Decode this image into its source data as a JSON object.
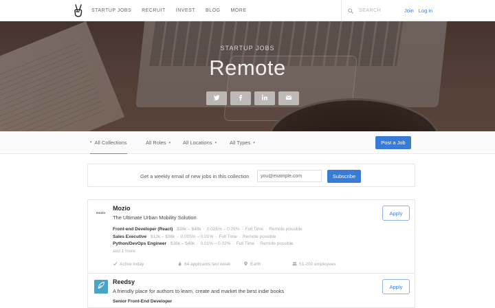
{
  "nav": {
    "links": [
      "STARTUP JOBS",
      "RECRUIT",
      "INVEST",
      "BLOG",
      "MORE"
    ],
    "search_placeholder": "SEARCH",
    "join": "Join",
    "login": "Log in"
  },
  "hero": {
    "subtitle": "STARTUP JOBS",
    "title": "Remote",
    "share_icons": [
      "twitter-icon",
      "facebook-icon",
      "linkedin-icon",
      "email-icon"
    ]
  },
  "filters": {
    "items": [
      "All Collections",
      "All Roles",
      "All Locations",
      "All Types"
    ],
    "post_job": "Post a Job"
  },
  "subscribe": {
    "text": "Get a weekly email of new jobs in this collection",
    "placeholder": "you@example.com",
    "button": "Subscribe"
  },
  "companies": [
    {
      "logo_text": "mozio",
      "name": "Mozio",
      "tagline": "The Ultimate Urban Mobility Solution",
      "apply": "Apply",
      "jobs": [
        {
          "title": "Front-end Developer (React)",
          "salary": "$36k – $48k",
          "equity": "0.025% – 0.05%",
          "type": "Full Time",
          "remote": "Remote possible"
        },
        {
          "title": "Sales Executive",
          "salary": "$12k – $36k",
          "equity": "0.005% – 0.01%",
          "type": "Full Time",
          "remote": "Remote possible"
        },
        {
          "title": "Python/DevOps Engineer",
          "salary": "$36k – $48k",
          "equity": "0.01% – 0.02%",
          "type": "Full Time",
          "remote": "Remote possible"
        }
      ],
      "more": "and 1 more",
      "meta": {
        "active": "Active today",
        "applicants": "64 applicants last week",
        "location": "Earth",
        "employees": "51-200 employees"
      }
    },
    {
      "name": "Reedsy",
      "tagline": "A friendly place for authors to learn, create and market the best indie books",
      "apply": "Apply",
      "jobs": [
        {
          "title": "Senior Front-End Developer"
        }
      ]
    }
  ],
  "colors": {
    "accent": "#3a7bd5",
    "reedsy_brand": "#4aa4c8"
  }
}
